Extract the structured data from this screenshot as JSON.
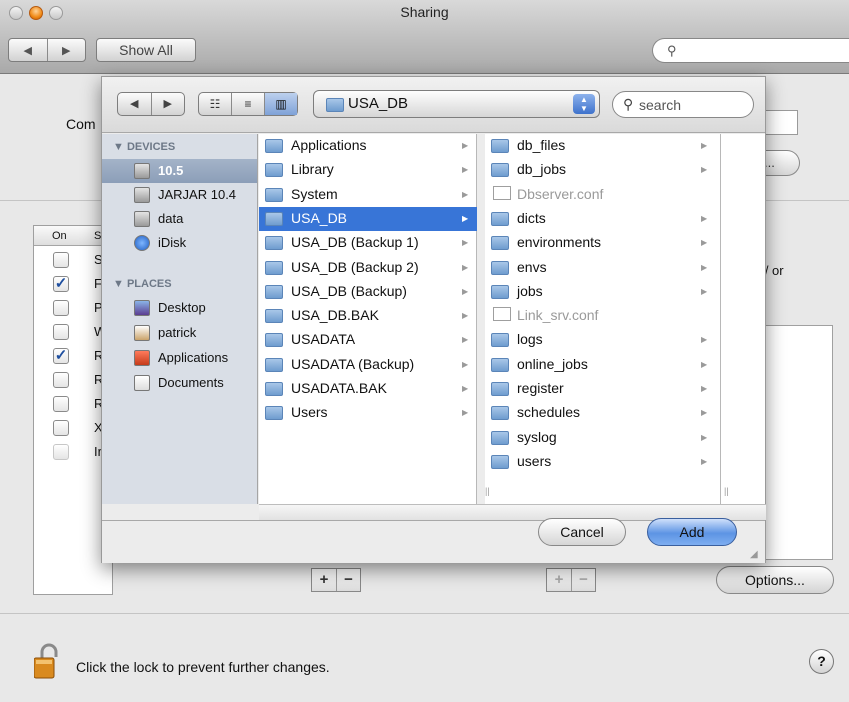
{
  "window": {
    "title": "Sharing",
    "show_all": "Show All",
    "nav_back": "◀",
    "nav_forward": "▶"
  },
  "background": {
    "computer_label": "Com",
    "edit_label": "...",
    "table_header": {
      "on": "On",
      "service": "S"
    },
    "rows": [
      {
        "letter": "S",
        "checked": false
      },
      {
        "letter": "F",
        "checked": true
      },
      {
        "letter": "P",
        "checked": false
      },
      {
        "letter": "W",
        "checked": false
      },
      {
        "letter": "R",
        "checked": true
      },
      {
        "letter": "R",
        "checked": false
      },
      {
        "letter": "R",
        "checked": false
      },
      {
        "letter": "X",
        "checked": false
      },
      {
        "letter": "Ir",
        "checked": false
      }
    ],
    "right_text": "m/ or",
    "options": "Options...",
    "lock_text": "Click the lock to prevent further changes.",
    "help": "?"
  },
  "sheet": {
    "path": "USA_DB",
    "search_placeholder": "search",
    "view_buttons": [
      "☷",
      "≡",
      "▥"
    ],
    "sidebar": {
      "devices_header": "▼ DEVICES",
      "devices": [
        {
          "label": "10.5",
          "icon": "hard-drive-icon",
          "selected": true
        },
        {
          "label": "JARJAR 10.4",
          "icon": "hard-drive-icon",
          "selected": false
        },
        {
          "label": "data",
          "icon": "hard-drive-icon",
          "selected": false
        },
        {
          "label": "iDisk",
          "icon": "idisk-icon",
          "selected": false
        }
      ],
      "places_header": "▼ PLACES",
      "places": [
        {
          "label": "Desktop",
          "icon": "desktop-icon"
        },
        {
          "label": "patrick",
          "icon": "home-icon"
        },
        {
          "label": "Applications",
          "icon": "applications-icon"
        },
        {
          "label": "Documents",
          "icon": "documents-icon"
        }
      ]
    },
    "column1": [
      {
        "label": "Applications",
        "arrow": true
      },
      {
        "label": "Library",
        "arrow": true
      },
      {
        "label": "System",
        "arrow": true
      },
      {
        "label": "USA_DB",
        "arrow": true,
        "selected": true
      },
      {
        "label": "USA_DB (Backup 1)",
        "arrow": true
      },
      {
        "label": "USA_DB (Backup 2)",
        "arrow": true
      },
      {
        "label": "USA_DB (Backup)",
        "arrow": true
      },
      {
        "label": "USA_DB.BAK",
        "arrow": true
      },
      {
        "label": "USADATA",
        "arrow": true
      },
      {
        "label": "USADATA (Backup)",
        "arrow": true
      },
      {
        "label": "USADATA.BAK",
        "arrow": true
      },
      {
        "label": "Users",
        "arrow": true
      }
    ],
    "column2": [
      {
        "label": "db_files",
        "arrow": true
      },
      {
        "label": "db_jobs",
        "arrow": true
      },
      {
        "label": "Dbserver.conf",
        "arrow": false,
        "file": true
      },
      {
        "label": "dicts",
        "arrow": true
      },
      {
        "label": "environments",
        "arrow": true
      },
      {
        "label": "envs",
        "arrow": true
      },
      {
        "label": "jobs",
        "arrow": true
      },
      {
        "label": "Link_srv.conf",
        "arrow": false,
        "file": true
      },
      {
        "label": "logs",
        "arrow": true
      },
      {
        "label": "online_jobs",
        "arrow": true
      },
      {
        "label": "register",
        "arrow": true
      },
      {
        "label": "schedules",
        "arrow": true
      },
      {
        "label": "syslog",
        "arrow": true
      },
      {
        "label": "users",
        "arrow": true
      }
    ],
    "cancel": "Cancel",
    "add": "Add"
  },
  "colors": {
    "selection": "#3875d7",
    "sidebar_bg": "#d9dee6",
    "add_button": "#5d94e4"
  }
}
